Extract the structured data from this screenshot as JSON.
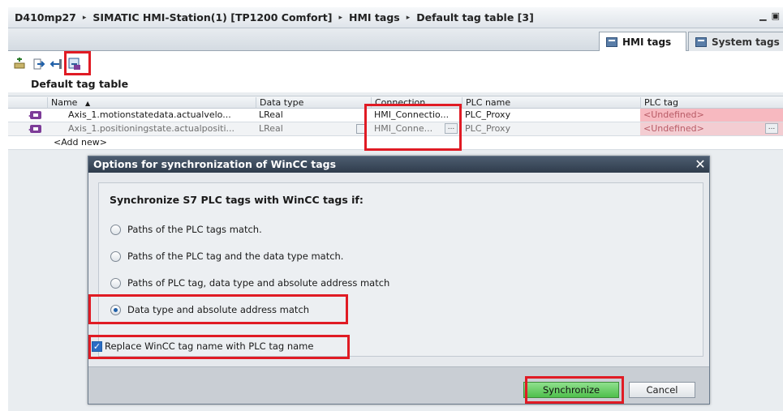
{
  "breadcrumb": {
    "items": [
      "D410mp27",
      "SIMATIC HMI-Station(1) [TP1200 Comfort]",
      "HMI tags",
      "Default tag table [3]"
    ],
    "separator": "▸"
  },
  "window_buttons": {
    "minimize": "▁",
    "restore": "▣"
  },
  "tabs": [
    {
      "label": "HMI tags",
      "icon": "hmi-tags-icon",
      "active": true
    },
    {
      "label": "System tags",
      "icon": "system-tags-icon",
      "active": false
    }
  ],
  "toolbar": {
    "buttons": [
      "add-tag-icon",
      "export-icon",
      "import-icon",
      "synchronize-tags-icon"
    ],
    "highlighted": "synchronize-tags-icon"
  },
  "table": {
    "title": "Default tag table",
    "columns": [
      "Name",
      "Data type",
      "Connection",
      "PLC name",
      "PLC tag"
    ],
    "sort_indicator": "▲",
    "rows": [
      {
        "name": "Axis_1.motionstatedata.actualvelo...",
        "data_type": "LReal",
        "connection": "HMI_Connectio...",
        "plc_name": "PLC_Proxy",
        "plc_tag": "<Undefined>"
      },
      {
        "name": "Axis_1.positioningstate.actualpositi...",
        "data_type": "LReal",
        "connection": "HMI_Conne...",
        "plc_name": "PLC_Proxy",
        "plc_tag": "<Undefined>"
      }
    ],
    "add_new": "<Add new>",
    "ellipsis": "..."
  },
  "dialog": {
    "title": "Options for synchronization of WinCC tags",
    "close": "✕",
    "heading": "Synchronize S7 PLC tags with WinCC tags if:",
    "options": [
      {
        "label": "Paths of the PLC tags match.",
        "checked": false
      },
      {
        "label": "Paths of the PLC tag and the data type match.",
        "checked": false
      },
      {
        "label": "Paths of PLC tag, data type and absolute address match",
        "checked": false
      },
      {
        "label": "Data type and absolute address match",
        "checked": true
      }
    ],
    "checkbox": {
      "label": "Replace WinCC tag name with PLC tag name",
      "checked": true
    },
    "buttons": {
      "synchronize": "Synchronize",
      "cancel": "Cancel"
    }
  },
  "colors": {
    "highlight": "#e01b24",
    "sync_button": "#4fbf4c",
    "undefined_cell": "#f7b9c0",
    "dialog_title": "#2f3c4c"
  }
}
